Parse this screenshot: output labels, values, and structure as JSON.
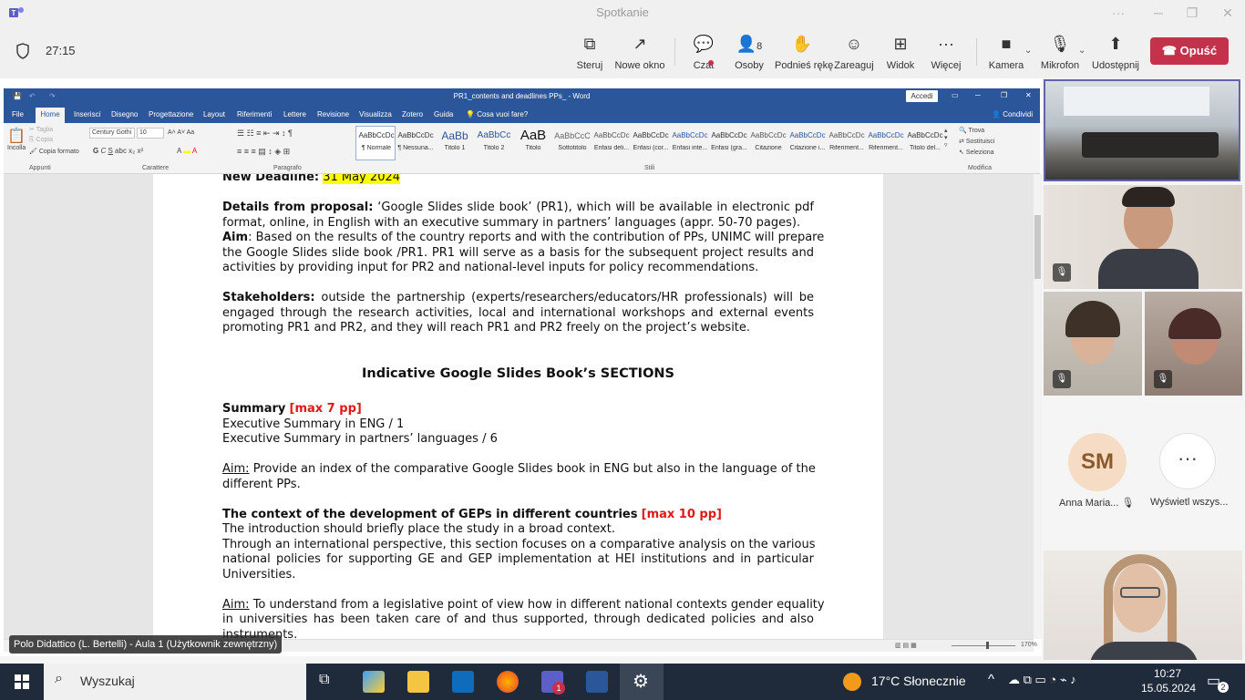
{
  "window": {
    "title": "Spotkanie"
  },
  "meeting": {
    "timer": "27:15",
    "tools": {
      "steruj": "Steruj",
      "nowe_okno": "Nowe okno",
      "czat": "Czat",
      "osoby": "Osoby",
      "osoby_count": "8",
      "podnies": "Podnieś rękę",
      "zareaguj": "Zareaguj",
      "widok": "Widok",
      "wiecej": "Więcej",
      "kamera": "Kamera",
      "mikrofon": "Mikrofon",
      "udostepnij": "Udostępnij"
    },
    "leave_label": "Opuść"
  },
  "word": {
    "doc_title": "PR1_contents and deadlines PPs_ - Word",
    "signin": "Accedi",
    "menu": [
      "File",
      "Home",
      "Inserisci",
      "Disegno",
      "Progettazione",
      "Layout",
      "Riferimenti",
      "Lettere",
      "Revisione",
      "Visualizza",
      "Zotero",
      "Guida"
    ],
    "tell_me": "Cosa vuoi fare?",
    "share": "Condividi",
    "clipboard": {
      "paste": "Incolla",
      "cut": "Taglia",
      "copy": "Copia",
      "format": "Copia formato"
    },
    "font": {
      "name": "Century Gothi",
      "size": "10"
    },
    "styles": [
      {
        "preview": "AaBbCcDc",
        "name": "¶ Normale"
      },
      {
        "preview": "AaBbCcDc",
        "name": "¶ Nessuna..."
      },
      {
        "preview": "AaBb",
        "name": "Titolo 1"
      },
      {
        "preview": "AaBbCc",
        "name": "Titolo 2"
      },
      {
        "preview": "AaB",
        "name": "Titolo"
      },
      {
        "preview": "AaBbCcC",
        "name": "Sottotitolo"
      },
      {
        "preview": "AaBbCcDc",
        "name": "Enfasi deli..."
      },
      {
        "preview": "AaBbCcDc",
        "name": "Enfasi (cor..."
      },
      {
        "preview": "AaBbCcDc",
        "name": "Enfasi inte..."
      },
      {
        "preview": "AaBbCcDc",
        "name": "Enfasi (gra..."
      },
      {
        "preview": "AaBbCcDc",
        "name": "Citazione"
      },
      {
        "preview": "AaBbCcDc",
        "name": "Citazione i..."
      },
      {
        "preview": "AaBbCcDc",
        "name": "Riferiment..."
      },
      {
        "preview": "AaBbCcDc",
        "name": "Riferiment..."
      },
      {
        "preview": "AaBbCcDc",
        "name": "Titolo del..."
      }
    ],
    "edit": {
      "find": "Trova",
      "replace": "Sostituisci",
      "select": "Seleziona"
    },
    "groups": {
      "clipboard": "Appunti",
      "font": "Carattere",
      "paragraph": "Paragrafo",
      "styles": "Stili",
      "edit": "Modifica"
    },
    "zoom": "170%"
  },
  "doc": {
    "deadline_label": "New Deadline:",
    "deadline_value": "31 May 2024",
    "details": {
      "label": "Details from proposal:",
      "l1": "‘Google Slides slide book’ (PR1), which will be available in electronic pdf",
      "l2": "format, online, in English with an executive summary in partners’ languages (appr. 50-70 pages)."
    },
    "aim1": {
      "label": "Aim",
      "l1": ":  Based on the results of the country reports and with the contribution of PPs, UNIMC will prepare",
      "l2": "the Google Slides slide book /PR1. PR1 will serve as a basis for the subsequent project results and",
      "l3": "activities by providing input for PR2 and national-level inputs for policy recommendations."
    },
    "stakeholders": {
      "label": "Stakeholders:",
      "l1": "outside the partnership (experts/researchers/educators/HR professionals) will be",
      "l2": "engaged through the research activities, local and international workshops and external events",
      "l3": "promoting PR1 and PR2, and they will reach PR1 and PR2 freely on the project’s website."
    },
    "sections_heading": "Indicative Google Slides Book’s SECTIONS",
    "summary": {
      "title": "Summary",
      "max": "[max 7 pp]",
      "l1": "Executive Summary in ENG / 1",
      "l2": "Executive Summary in partners’ languages / 6",
      "aim_label": "Aim:",
      "aim_l1": " Provide an index of the comparative Google Slides book in ENG but also in the language of the",
      "aim_l2": "different PPs."
    },
    "context": {
      "title": "The context of the development of GEPs in different countries",
      "max": "[max 10 pp]",
      "l1": "The introduction should briefly place the study in a broad context.",
      "l2": "Through an international perspective, this section focuses on a comparative analysis on the various",
      "l3": "national policies for supporting GE and GEP implementation at HEI institutions and in particular",
      "l4": "Universities.",
      "aim_label": "Aim:",
      "aim_l1": " To understand from a legislative point of view how in different national contexts gender equality",
      "aim_l2": "in universities has been taken care of and thus supported, through dedicated policies and also",
      "aim_l3": "instruments."
    }
  },
  "presenter": "Polo Didattico (L. Bertelli) - Aula 1 (Użytkownik zewnętrzny)",
  "participants": {
    "avatar_initials": "SM",
    "anna": "Anna Maria...",
    "show_all": "Wyświetl wszys..."
  },
  "taskbar": {
    "search": "Wyszukaj",
    "weather": "17°C  Słonecznie",
    "time": "10:27",
    "date": "15.05.2024",
    "teams_badge": "1",
    "notif_badge": "2"
  },
  "colors": {
    "word_blue": "#2b579a",
    "leave_red": "#c4314b",
    "highlight": "#ffff00",
    "deadline_red": "#e01818"
  }
}
